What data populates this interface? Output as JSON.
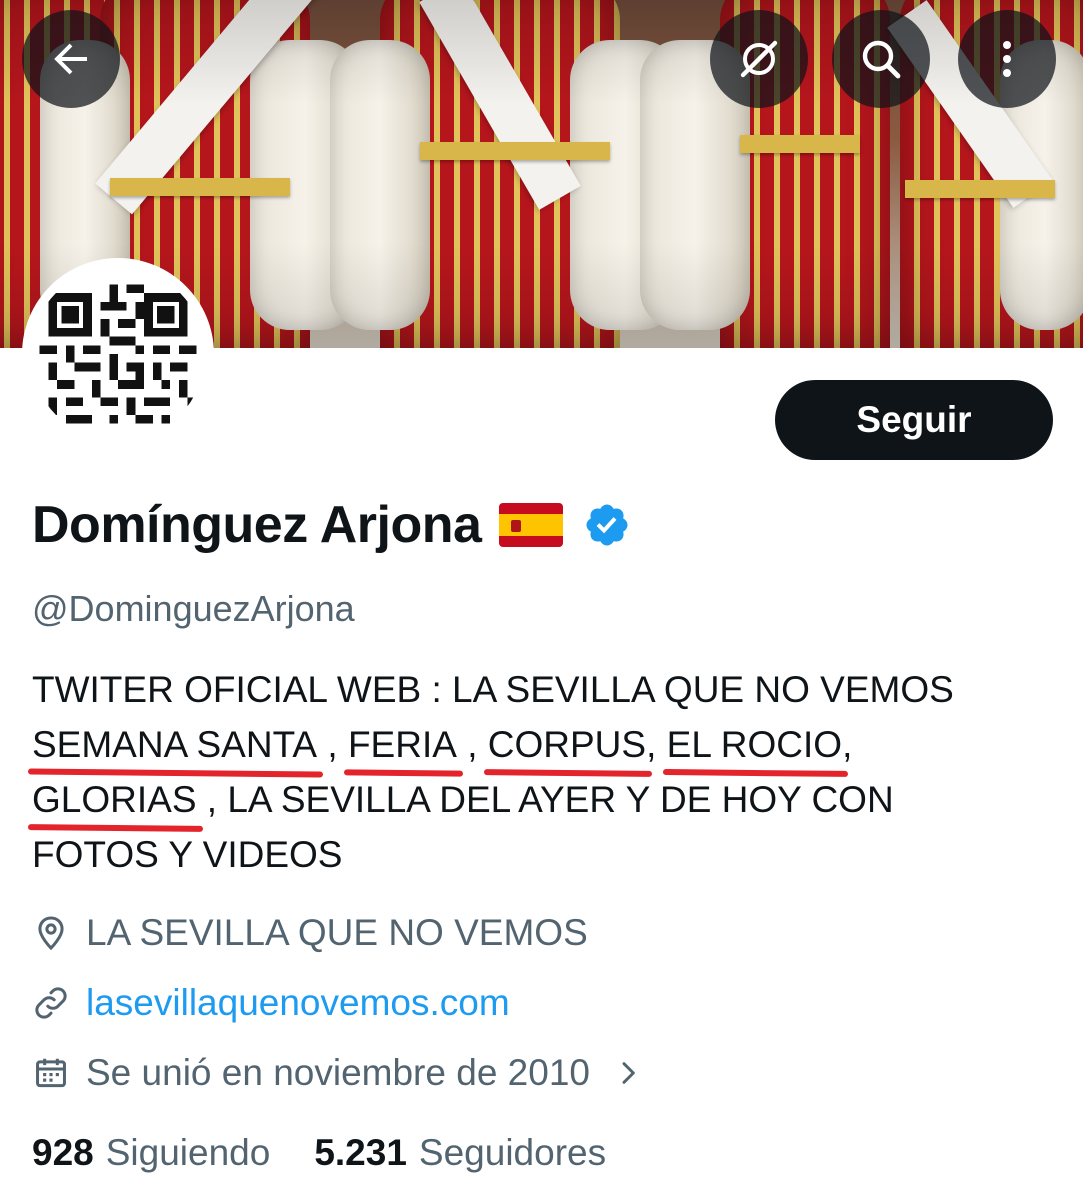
{
  "header": {
    "back_icon": "arrow-left-icon",
    "grok_icon": "grok-icon",
    "search_icon": "search-icon",
    "more_icon": "more-vertical-icon"
  },
  "profile": {
    "display_name": "Domínguez Arjona",
    "flag_icon": "spain-flag-icon",
    "verified_icon": "verified-badge-icon",
    "handle": "@DominguezArjona",
    "follow_label": "Seguir"
  },
  "bio": {
    "line1": "TWITER OFICIAL WEB : LA SEVILLA QUE NO VEMOS",
    "semana_santa": "SEMANA SANTA",
    "sep1": " , ",
    "feria": "FERIA",
    "sep2": " , ",
    "corpus": "CORPUS",
    "sep3": ", ",
    "el_rocio": "EL ROCIO",
    "sep4": ",",
    "glorias": "GLORIAS",
    "rest": " , LA SEVILLA DEL AYER Y DE HOY CON",
    "line4": "FOTOS Y VIDEOS"
  },
  "meta": {
    "location": "LA SEVILLA QUE NO VEMOS",
    "website": "lasevillaquenovemos.com",
    "joined": "Se unió en noviembre de 2010"
  },
  "stats": {
    "following_count": "928",
    "following_label": "Siguiendo",
    "followers_count": "5.231",
    "followers_label": "Seguidores"
  },
  "colors": {
    "link": "#1d9bf0",
    "secondary_text": "#536471",
    "primary_text": "#0f1419",
    "highlight_underline": "#e3242b",
    "follow_button": "#0f1419"
  }
}
